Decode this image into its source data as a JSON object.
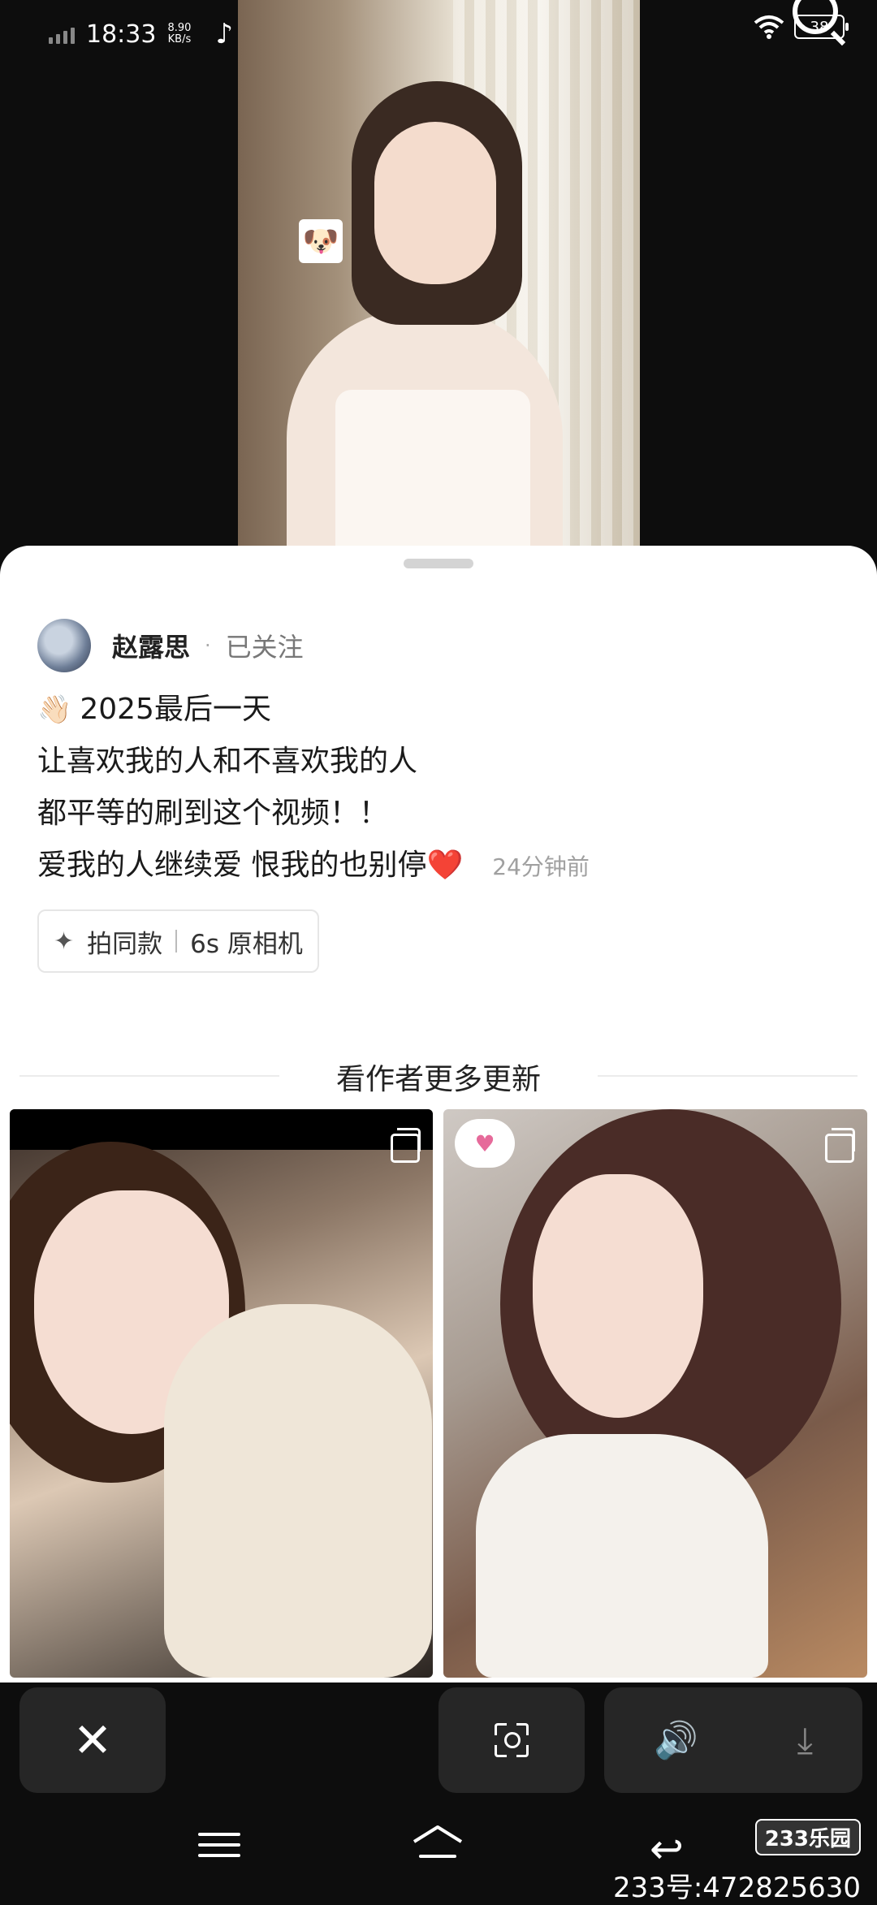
{
  "status_bar": {
    "time": "18:33",
    "net_speed_value": "8.90",
    "net_speed_unit": "KB/s",
    "battery": "38",
    "tiktok_icon": "tiktok-icon"
  },
  "post": {
    "author_name": "赵露思",
    "separator": "·",
    "follow_status": "已关注",
    "description": {
      "line1_emoji": "👋🏻",
      "line1": "2025最后一天",
      "line2": "让喜欢我的人和不喜欢我的人",
      "line3": "都平等的刷到这个视频！！",
      "line4": "爱我的人继续爱 恨我的也别停",
      "line4_emoji": "❤️"
    },
    "time_ago": "24分钟前",
    "tag_chip": {
      "icon": "sparkle-icon",
      "label": "拍同款",
      "camera": "6s 原相机"
    }
  },
  "more_section": {
    "title": "看作者更多更新"
  },
  "controls": {
    "close_icon": "✕",
    "scan_icon": "scan-search-icon",
    "speaker_icon": "🔊",
    "download_icon": "⤓"
  },
  "navbar": {
    "back_icon": "↩"
  },
  "watermark": {
    "logo": "233乐园",
    "id": "233号:472825630"
  },
  "colors": {
    "background": "#0d0d0d",
    "sheet": "#ffffff",
    "control_button": "#262626",
    "heart": "#e53935"
  }
}
